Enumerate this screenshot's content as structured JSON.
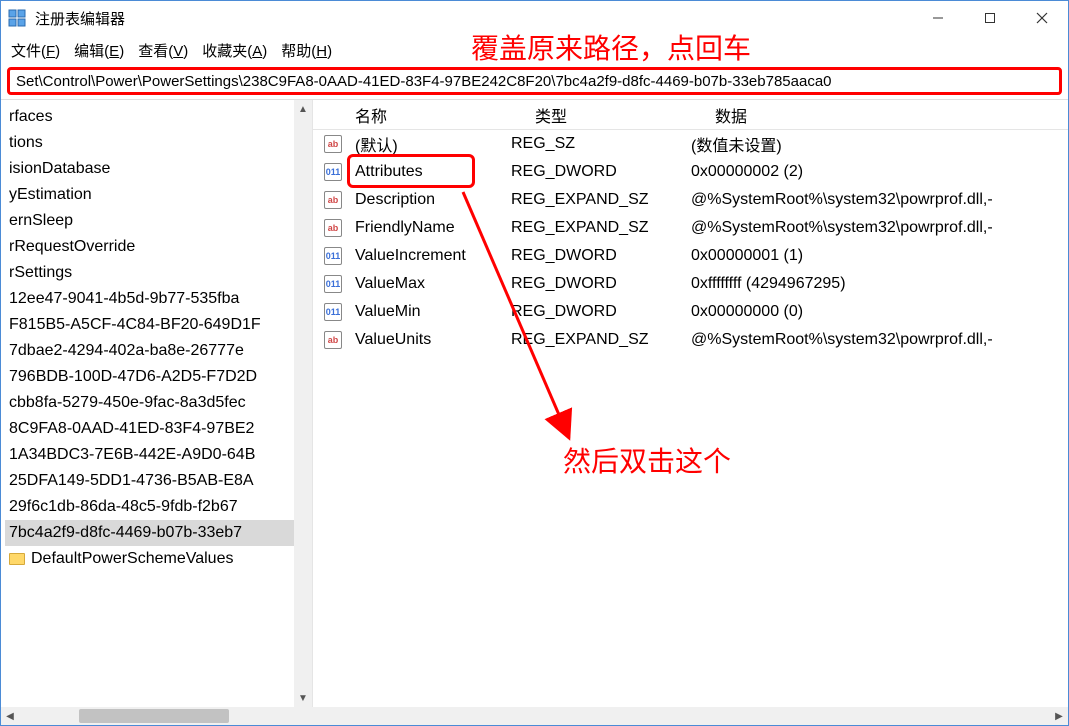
{
  "window": {
    "title": "注册表编辑器"
  },
  "annotations": {
    "top": "覆盖原来路径，点回车",
    "mid": "然后双击这个"
  },
  "menubar": {
    "file": "文件(F)",
    "edit": "编辑(E)",
    "view": "查看(V)",
    "favorites": "收藏夹(A)",
    "help": "帮助(H)"
  },
  "addressbar": {
    "path": "Set\\Control\\Power\\PowerSettings\\238C9FA8-0AAD-41ED-83F4-97BE242C8F20\\7bc4a2f9-d8fc-4469-b07b-33eb785aaca0"
  },
  "tree": {
    "items": [
      "rfaces",
      "tions",
      "",
      "isionDatabase",
      "",
      "",
      "yEstimation",
      "ernSleep",
      "",
      "rRequestOverride",
      "rSettings",
      "12ee47-9041-4b5d-9b77-535fba",
      "F815B5-A5CF-4C84-BF20-649D1F",
      "7dbae2-4294-402a-ba8e-26777e",
      "796BDB-100D-47D6-A2D5-F7D2D",
      "cbb8fa-5279-450e-9fac-8a3d5fec",
      "8C9FA8-0AAD-41ED-83F4-97BE2",
      "1A34BDC3-7E6B-442E-A9D0-64B",
      "25DFA149-5DD1-4736-B5AB-E8A",
      "29f6c1db-86da-48c5-9fdb-f2b67",
      "7bc4a2f9-d8fc-4469-b07b-33eb7",
      "DefaultPowerSchemeValues"
    ],
    "selectedIndex": 20
  },
  "list": {
    "columns": {
      "name": "名称",
      "type": "类型",
      "data": "数据"
    },
    "rows": [
      {
        "icon": "sz",
        "name": "(默认)",
        "type": "REG_SZ",
        "data": "(数值未设置)"
      },
      {
        "icon": "dw",
        "name": "Attributes",
        "type": "REG_DWORD",
        "data": "0x00000002 (2)"
      },
      {
        "icon": "sz",
        "name": "Description",
        "type": "REG_EXPAND_SZ",
        "data": "@%SystemRoot%\\system32\\powrprof.dll,-"
      },
      {
        "icon": "sz",
        "name": "FriendlyName",
        "type": "REG_EXPAND_SZ",
        "data": "@%SystemRoot%\\system32\\powrprof.dll,-"
      },
      {
        "icon": "dw",
        "name": "ValueIncrement",
        "type": "REG_DWORD",
        "data": "0x00000001 (1)"
      },
      {
        "icon": "dw",
        "name": "ValueMax",
        "type": "REG_DWORD",
        "data": "0xffffffff (4294967295)"
      },
      {
        "icon": "dw",
        "name": "ValueMin",
        "type": "REG_DWORD",
        "data": "0x00000000 (0)"
      },
      {
        "icon": "sz",
        "name": "ValueUnits",
        "type": "REG_EXPAND_SZ",
        "data": "@%SystemRoot%\\system32\\powrprof.dll,-"
      }
    ]
  }
}
